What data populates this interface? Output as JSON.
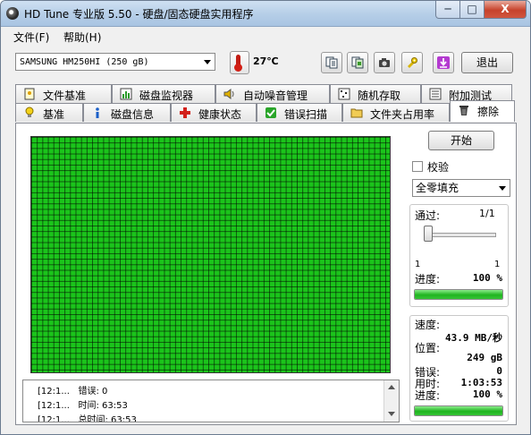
{
  "window": {
    "title": "HD Tune 专业版 5.50 - 硬盘/固态硬盘实用程序",
    "minimize": "─",
    "maximize": "□",
    "close": "X"
  },
  "menu": {
    "file": "文件(F)",
    "help": "帮助(H)"
  },
  "toolbar": {
    "drive": "SAMSUNG HM250HI (250 gB)",
    "temperature": "27℃",
    "exit_label": "退出",
    "buttons": [
      "copy-text-icon",
      "copy-screenshot-icon",
      "camera-icon",
      "settings-icon",
      "download-icon"
    ]
  },
  "tabs_row1": [
    {
      "label": "文件基准",
      "icon": "file-benchmark-icon"
    },
    {
      "label": "磁盘监视器",
      "icon": "disk-monitor-icon"
    },
    {
      "label": "自动噪音管理",
      "icon": "speaker-icon"
    },
    {
      "label": "随机存取",
      "icon": "random-access-icon"
    },
    {
      "label": "附加测试",
      "icon": "extra-tests-icon"
    }
  ],
  "tabs_row2": [
    {
      "label": "基准",
      "icon": "bulb-icon"
    },
    {
      "label": "磁盘信息",
      "icon": "info-icon"
    },
    {
      "label": "健康状态",
      "icon": "health-cross-icon"
    },
    {
      "label": "错误扫描",
      "icon": "error-scan-icon"
    },
    {
      "label": "文件夹占用率",
      "icon": "folder-icon"
    },
    {
      "label": "擦除",
      "icon": "trash-icon"
    }
  ],
  "erase": {
    "start_label": "开始",
    "verify_label": "校验",
    "verify_checked": false,
    "mode": "全零填充",
    "pass_label": "通过:",
    "pass_value": "1/1",
    "slider_min": "1",
    "slider_max": "1",
    "progress_label": "进度:",
    "progress_value": "100 %",
    "progress_fraction": 1.0,
    "speed_label": "速度:",
    "speed_value": "43.9 MB/秒",
    "position_label": "位置:",
    "position_value": "249 gB",
    "errors_label": "错误:",
    "errors_value": "0",
    "elapsed_label": "用时:",
    "elapsed_value": "1:03:53",
    "total_progress_label": "进度:",
    "total_progress_value": "100 %",
    "total_progress_fraction": 1.0
  },
  "grid_status": "all-blocks-ok",
  "grid_color": "#1bc41b",
  "log": [
    {
      "time": "[12:1...",
      "text": "错误: 0"
    },
    {
      "time": "[12:1...",
      "text": "时间: 63:53"
    },
    {
      "time": "[12:1...",
      "text": "总时间: 63:53"
    }
  ]
}
